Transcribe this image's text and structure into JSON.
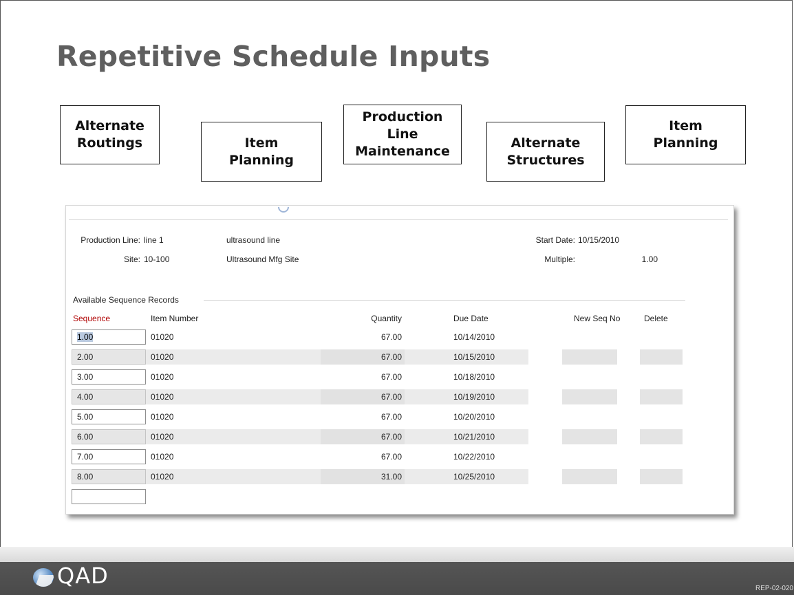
{
  "slide": {
    "title": "Repetitive Schedule Inputs",
    "boxes": [
      {
        "label": "Alternate\nRoutings"
      },
      {
        "label": "Item\nPlanning"
      },
      {
        "label": "Production\nLine\nMaintenance"
      },
      {
        "label": "Alternate\nStructures"
      },
      {
        "label": "Item\nPlanning"
      }
    ]
  },
  "form": {
    "production_line_label": "Production Line:",
    "production_line_value": "line 1",
    "production_line_desc": "ultrasound line",
    "site_label": "Site:",
    "site_value": "10-100",
    "site_desc": "Ultrasound Mfg Site",
    "start_date_label": "Start Date:",
    "start_date_value": "10/15/2010",
    "multiple_label": "Multiple:",
    "multiple_value": "1.00",
    "section_title": "Available Sequence Records",
    "columns": {
      "sequence": "Sequence",
      "item_number": "Item Number",
      "quantity": "Quantity",
      "due_date": "Due Date",
      "new_seq_no": "New Seq No",
      "delete": "Delete"
    },
    "rows": [
      {
        "sequence": "1.00",
        "item_number": "01020",
        "quantity": "67.00",
        "due_date": "10/14/2010"
      },
      {
        "sequence": "2.00",
        "item_number": "01020",
        "quantity": "67.00",
        "due_date": "10/15/2010"
      },
      {
        "sequence": "3.00",
        "item_number": "01020",
        "quantity": "67.00",
        "due_date": "10/18/2010"
      },
      {
        "sequence": "4.00",
        "item_number": "01020",
        "quantity": "67.00",
        "due_date": "10/19/2010"
      },
      {
        "sequence": "5.00",
        "item_number": "01020",
        "quantity": "67.00",
        "due_date": "10/20/2010"
      },
      {
        "sequence": "6.00",
        "item_number": "01020",
        "quantity": "67.00",
        "due_date": "10/21/2010"
      },
      {
        "sequence": "7.00",
        "item_number": "01020",
        "quantity": "67.00",
        "due_date": "10/22/2010"
      },
      {
        "sequence": "8.00",
        "item_number": "01020",
        "quantity": "31.00",
        "due_date": "10/25/2010"
      }
    ]
  },
  "footer": {
    "logo_text": "QAD",
    "slide_code": "REP-02-020"
  }
}
